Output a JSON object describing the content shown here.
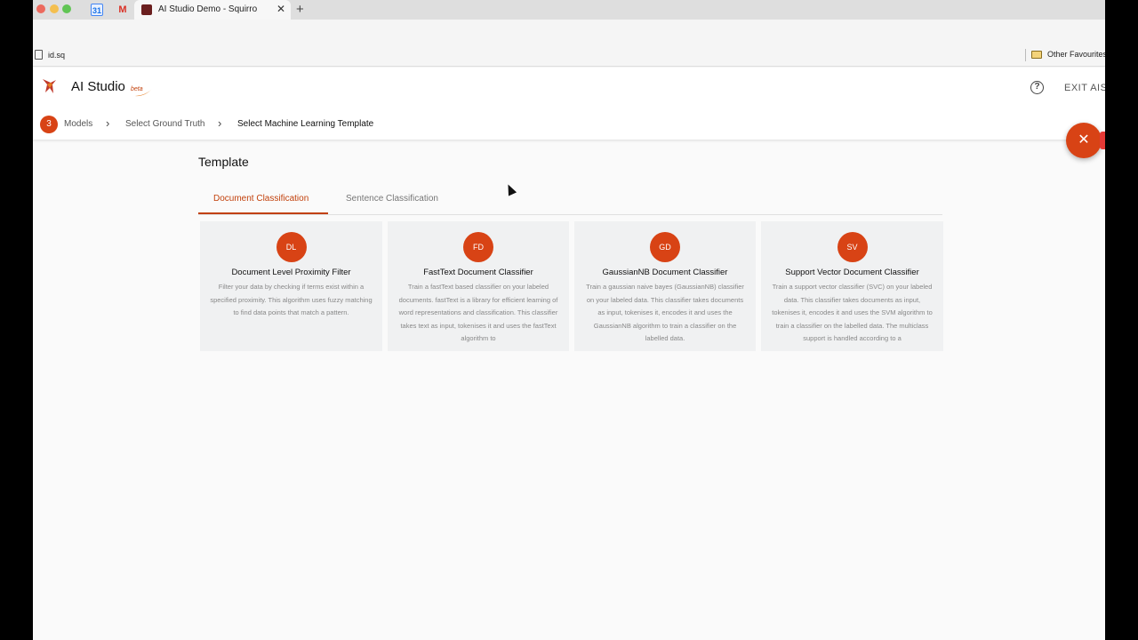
{
  "browser": {
    "tab_title": "AI Studio Demo - Squirro",
    "tab_close": "✕",
    "new_tab": "+",
    "bookmark_1": "id.sq",
    "bookmark_folder": "Other Favourites"
  },
  "header": {
    "app_title": "AI Studio",
    "beta": "beta",
    "help": "?",
    "exit": "EXIT AISTUDIO",
    "step_number": "3",
    "breadcrumb": [
      "Models",
      "Select Ground Truth",
      "Select Machine Learning Template"
    ],
    "chevron": "›",
    "fab": "✕"
  },
  "main": {
    "title": "Template",
    "tabs": [
      "Document Classification",
      "Sentence Classification"
    ],
    "cards": [
      {
        "initials": "DL",
        "title": "Document Level Proximity Filter",
        "description": "Filter your data by checking if terms exist within a specified proximity. This algorithm uses fuzzy matching to find data points that match a pattern."
      },
      {
        "initials": "FD",
        "title": "FastText Document Classifier",
        "description": "Train a fastText based classifier on your labeled documents. fastText is a library for efficient learning of word representations and classification. This classifier takes text as input, tokenises it and uses the fastText algorithm to"
      },
      {
        "initials": "GD",
        "title": "GaussianNB Document Classifier",
        "description": "Train a gaussian naive bayes (GaussianNB) classifier on your labeled data. This classifier takes documents as input, tokenises it, encodes it and uses the GaussianNB algorithm to train a classifier on the labelled data."
      },
      {
        "initials": "SV",
        "title": "Support Vector Document Classifier",
        "description": "Train a support vector classifier (SVC) on your labeled data. This classifier takes documents as input, tokenises it, encodes it and uses the SVM algorithm to train a classifier on the labelled data. The multiclass support is handled according to a"
      }
    ]
  },
  "colors": {
    "accent": "#d84315",
    "tab_active": "#c2410c",
    "card_bg": "#f0f1f2"
  }
}
